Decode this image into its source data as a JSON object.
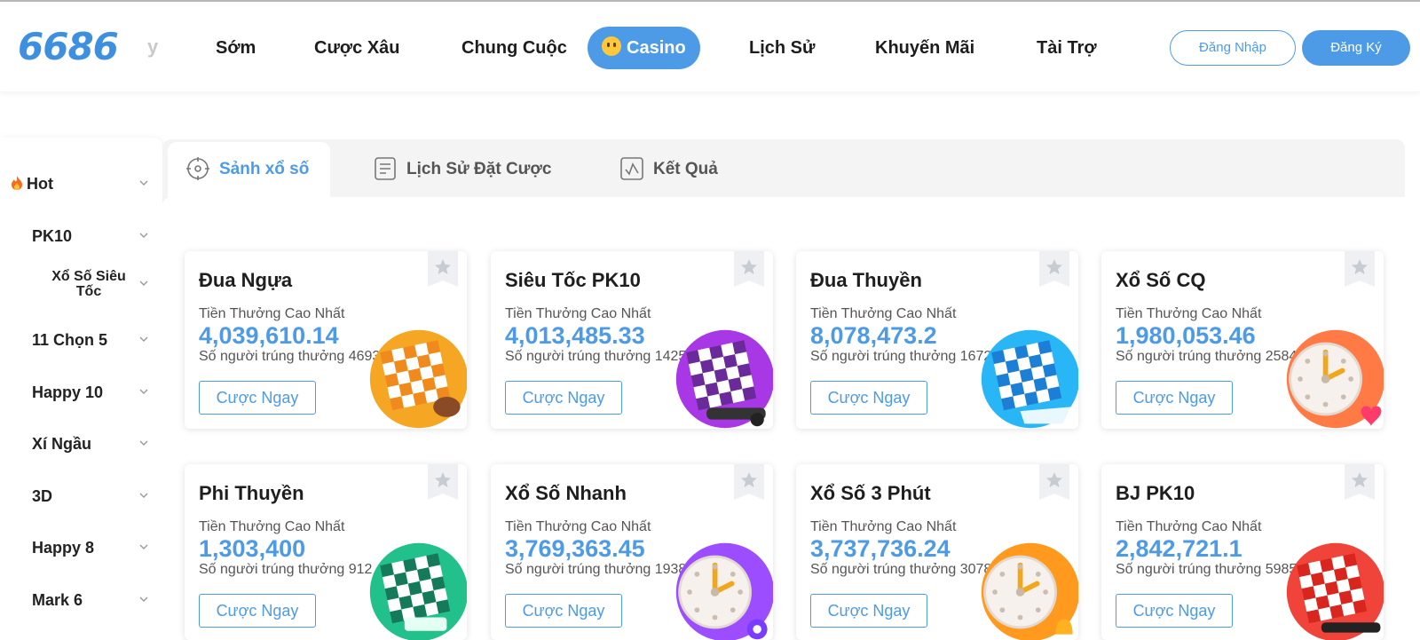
{
  "header": {
    "logo": "6686",
    "logo_ghost": "y",
    "nav": [
      {
        "label": "Sớm"
      },
      {
        "label": "Cược Xâu"
      },
      {
        "label": "Chung Cuộc"
      },
      {
        "label": "Casino",
        "active": true
      },
      {
        "label": "Lịch Sử"
      },
      {
        "label": "Khuyến Mãi"
      },
      {
        "label": "Tài Trợ"
      }
    ],
    "login_label": "Đăng Nhập",
    "register_label": "Đăng Ký"
  },
  "sidebar": {
    "items": [
      {
        "label": "Hot",
        "icon": "flame-icon"
      },
      {
        "label": "PK10"
      },
      {
        "label": "Xổ Số Siêu Tốc"
      },
      {
        "label": "11 Chọn 5"
      },
      {
        "label": "Happy 10"
      },
      {
        "label": "Xí Ngầu"
      },
      {
        "label": "3D"
      },
      {
        "label": "Happy 8"
      },
      {
        "label": "Mark 6"
      }
    ]
  },
  "tabs": [
    {
      "label": "Sảnh xổ số",
      "icon": "target-icon",
      "active": true
    },
    {
      "label": "Lịch Sử Đặt Cược",
      "icon": "document-icon"
    },
    {
      "label": "Kết Quả",
      "icon": "chart-icon"
    }
  ],
  "cards_common": {
    "prize_label": "Tiền Thưởng Cao Nhất",
    "winners_prefix": "Số người trúng thưởng",
    "button_label": "Cược Ngay"
  },
  "cards": [
    {
      "title": "Đua Ngựa",
      "prize": "4,039,610.14",
      "winners": "Số người trúng thưởng 4693",
      "art": "horse-flag",
      "color": "#f5a623"
    },
    {
      "title": "Siêu Tốc PK10",
      "prize": "4,013,485.33",
      "winners": "Số người trúng thưởng 1425",
      "art": "race-car-flag",
      "color": "#a838e6"
    },
    {
      "title": "Đua Thuyền",
      "prize": "8,078,473.2",
      "winners": "Số người trúng thưởng 1672",
      "art": "boat-flag",
      "color": "#29b6f6"
    },
    {
      "title": "Xổ Số CQ",
      "prize": "1,980,053.46",
      "winners": "Số người trúng thưởng 2584",
      "art": "clock-heart",
      "color": "#ff7a45"
    },
    {
      "title": "Phi Thuyền",
      "prize": "1,303,400",
      "winners": "Số người trúng thưởng 912",
      "art": "ship-flag",
      "color": "#22c08a"
    },
    {
      "title": "Xổ Số Nhanh",
      "prize": "3,769,363.45",
      "winners": "Số người trúng thưởng 1938",
      "art": "clock-flower",
      "color": "#9b4dff"
    },
    {
      "title": "Xổ Số 3 Phút",
      "prize": "3,737,736.24",
      "winners": "Số người trúng thưởng 3078",
      "art": "clock-bell",
      "color": "#ff9a1f"
    },
    {
      "title": "BJ PK10",
      "prize": "2,842,721.1",
      "winners": "Số người trúng thưởng 5985",
      "art": "red-car-flag",
      "color": "#f0443a"
    }
  ]
}
